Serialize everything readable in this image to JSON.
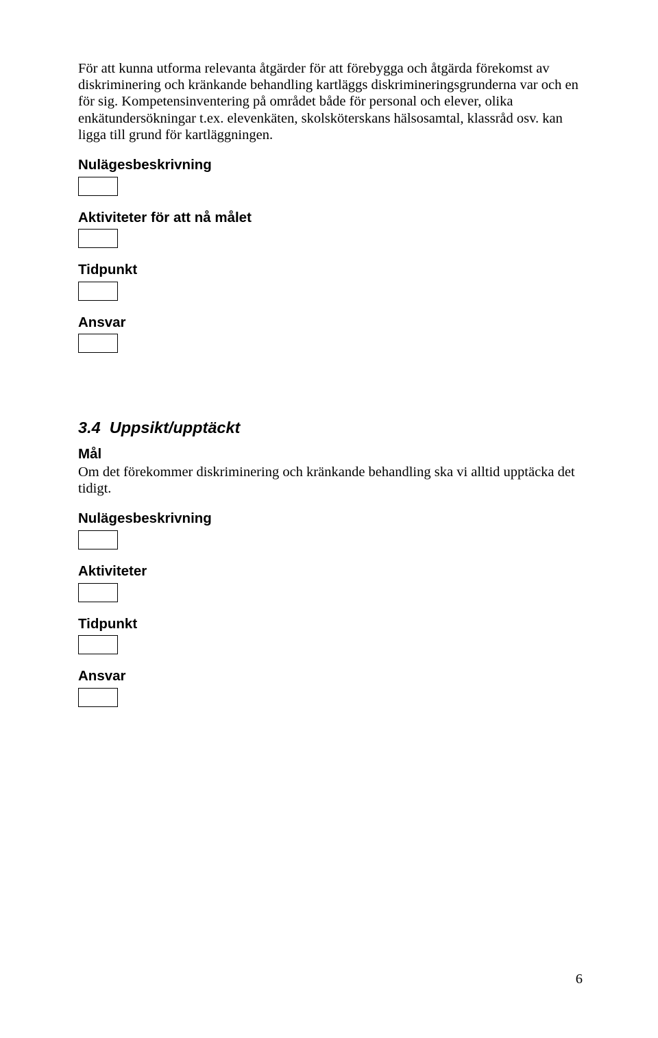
{
  "intro": "För att kunna utforma relevanta åtgärder för att förebygga och åtgärda förekomst av diskriminering och kränkande behandling kartläggs diskrimineringsgrunderna var och en för sig. Kompetensinventering på området både för personal och elever, olika enkätundersökningar t.ex. elevenkäten, skolsköterskans hälsosamtal, klassråd osv. kan ligga till grund för kartläggningen.",
  "labels": {
    "nulages": "Nulägesbeskrivning",
    "aktiviteter_mal": "Aktiviteter för att nå målet",
    "tidpunkt": "Tidpunkt",
    "ansvar": "Ansvar",
    "aktiviteter": "Aktiviteter"
  },
  "section": {
    "number": "3.4",
    "title": "Uppsikt/upptäckt",
    "mal_label": "Mål",
    "mal_text": "Om det förekommer diskriminering och kränkande behandling ska vi alltid upptäcka det tidigt."
  },
  "page_number": "6"
}
